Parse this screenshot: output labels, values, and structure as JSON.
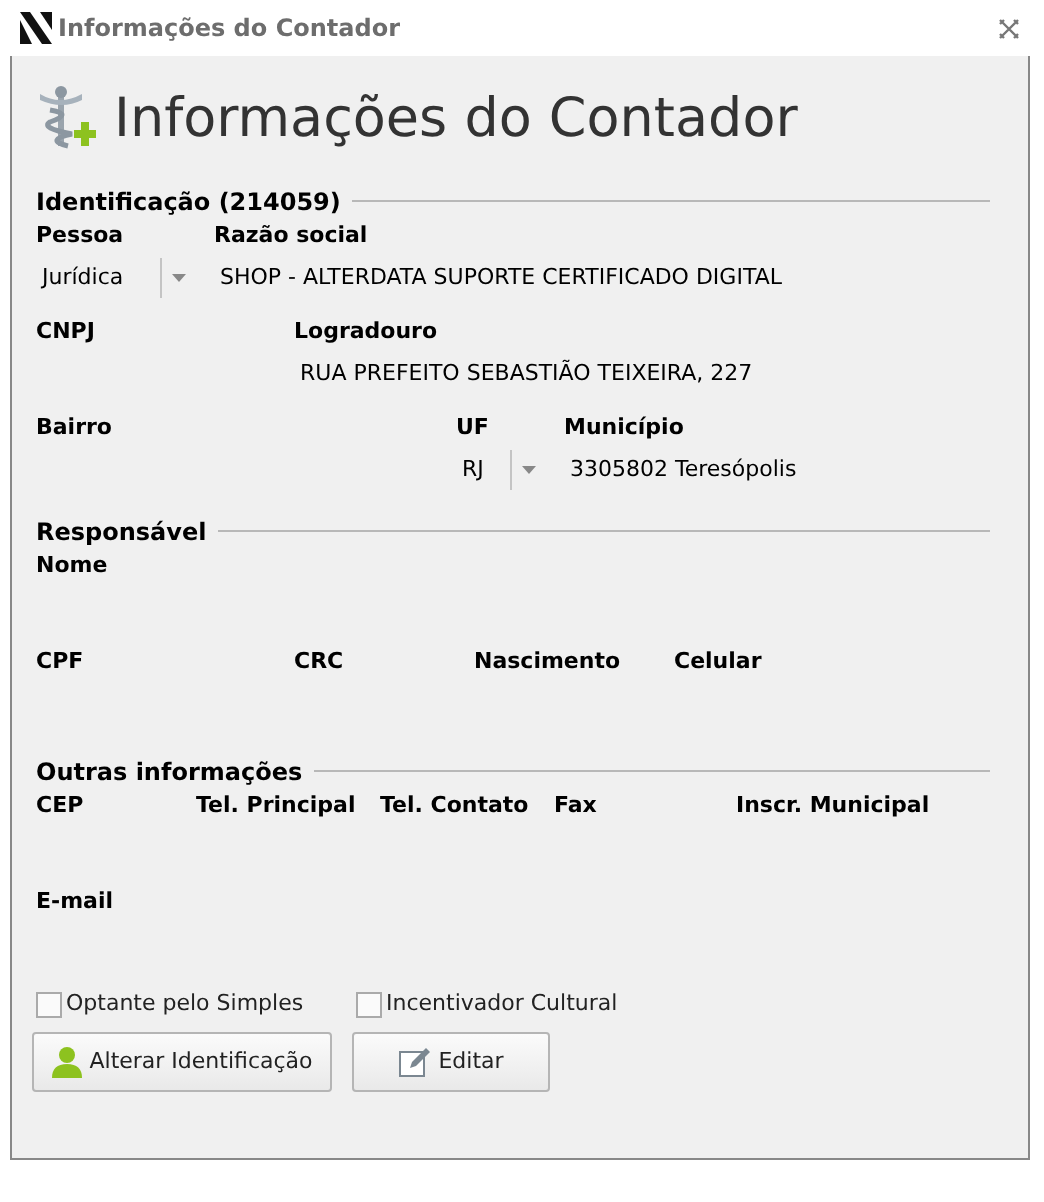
{
  "window": {
    "title": "Informações do Contador"
  },
  "header": {
    "title": "Informações do Contador"
  },
  "sections": [
    {
      "title": "Identificação (214059)",
      "rows": [
        [
          {
            "label": "Pessoa",
            "kind": "combo",
            "value": "Jurídica"
          },
          {
            "label": "Razão social",
            "kind": "text",
            "value": "SHOP - ALTERDATA SUPORTE CERTIFICADO DIGITAL"
          }
        ],
        [
          {
            "label": "CNPJ",
            "kind": "text"
          },
          {
            "label": "Logradouro",
            "kind": "text",
            "value": "RUA PREFEITO SEBASTIÃO TEIXEIRA, 227"
          }
        ],
        [
          {
            "label": "Bairro",
            "kind": "text"
          },
          {
            "label": "UF",
            "kind": "combo",
            "value": "RJ"
          },
          {
            "label": "Município",
            "kind": "text",
            "value": "3305802 Teresópolis"
          }
        ]
      ]
    },
    {
      "title": "Responsável",
      "rows": [
        [
          {
            "label": "Nome",
            "kind": "text"
          }
        ],
        [
          {
            "label": "CPF",
            "kind": "text"
          },
          {
            "label": "CRC",
            "kind": "text"
          },
          {
            "label": "Nascimento",
            "kind": "text"
          },
          {
            "label": "Celular",
            "kind": "text"
          }
        ]
      ]
    },
    {
      "title": "Outras informações",
      "rows": [
        [
          {
            "label": "CEP",
            "kind": "text"
          },
          {
            "label": "Tel. Principal",
            "kind": "text"
          },
          {
            "label": "Tel. Contato",
            "kind": "text"
          },
          {
            "label": "Fax",
            "kind": "text"
          },
          {
            "label": "Inscr. Municipal",
            "kind": "text"
          }
        ],
        [
          {
            "label": "E-mail",
            "kind": "text"
          }
        ]
      ]
    }
  ],
  "checkboxes": [
    {
      "label": "Optante pelo Simples",
      "checked": false
    },
    {
      "label": "Incentivador Cultural",
      "checked": false
    }
  ],
  "buttons": [
    {
      "label": "Alterar Identificação",
      "kind": "person"
    },
    {
      "label": "Editar",
      "kind": "edit"
    }
  ]
}
